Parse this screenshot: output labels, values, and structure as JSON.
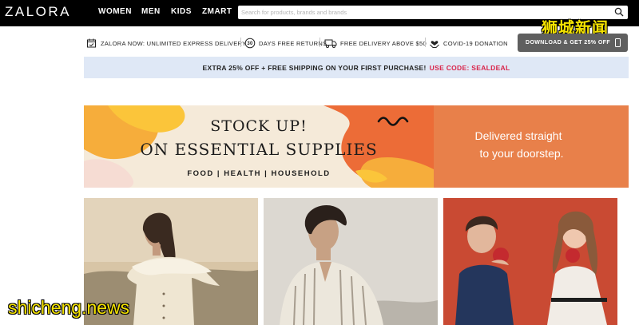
{
  "brand": {
    "logo_text": "ZALORA"
  },
  "nav": {
    "items": [
      {
        "label": "WOMEN"
      },
      {
        "label": "MEN"
      },
      {
        "label": "KIDS"
      },
      {
        "label": "ZMART"
      }
    ]
  },
  "search": {
    "placeholder": "Search for products, brands and brands",
    "value": "",
    "icon": "search-icon"
  },
  "usp": {
    "items": [
      {
        "label": "ZALORA NOW: UNLIMITED EXPRESS DELIVERY",
        "icon": "calendar-icon"
      },
      {
        "label": "DAYS FREE RETURNS",
        "icon": "return-30-icon",
        "icon_text": "30"
      },
      {
        "label": "FREE DELIVERY ABOVE $50",
        "icon": "truck-icon"
      },
      {
        "label": "COVID-19 DONATION",
        "icon": "heart-hands-icon"
      }
    ],
    "app_button": {
      "label": "DOWNLOAD & GET 25% OFF",
      "icon": "phone-icon"
    }
  },
  "promo_strip": {
    "text": "EXTRA 25% OFF + FREE SHIPPING ON YOUR FIRST PURCHASE!",
    "code_text": "USE CODE: SEALDEAL",
    "code_color": "#d9244a",
    "background": "#dfe8f6"
  },
  "hero_banner": {
    "title_line1": "STOCK UP!",
    "title_line2": "ON ESSENTIAL SUPPLIES",
    "subtitle": "FOOD | HEALTH | HOUSEHOLD",
    "right_line1": "Delivered straight",
    "right_line2": "to your doorstep.",
    "accent_color": "#e8804a",
    "blob_colors": [
      "#f6ad3b",
      "#fbc53a",
      "#ec6c37",
      "#f6dcd3"
    ]
  },
  "tiles": [
    {
      "alt": "women-fashion-tile"
    },
    {
      "alt": "men-fashion-tile"
    },
    {
      "alt": "kids-fashion-tile"
    }
  ],
  "watermark": {
    "top_text": "狮城新闻",
    "bottom_text": "shicheng.news",
    "color": "#f5e300"
  }
}
